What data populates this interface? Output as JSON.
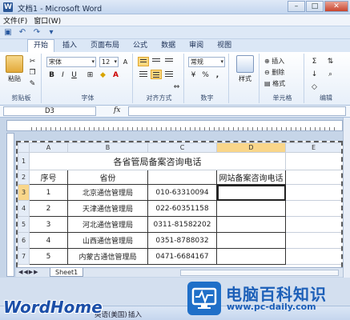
{
  "window": {
    "title": "文档1 - Microsoft Word",
    "app_icon": "W",
    "btn_min": "–",
    "btn_max": "□",
    "btn_close": "✕"
  },
  "menubar": {
    "items": [
      "文件(F)",
      "窗口(W)"
    ]
  },
  "ribbon_tabs": {
    "file": "文件",
    "items": [
      "开始",
      "插入",
      "页面布局",
      "公式",
      "数据",
      "审阅",
      "视图"
    ],
    "active_index": 0
  },
  "ribbon": {
    "clipboard_label": "剪贴板",
    "paste_label": "粘贴",
    "font_label": "字体",
    "font_name": "宋体",
    "font_size": "12",
    "align_label": "对齐方式",
    "number_label": "数字",
    "number_format": "常规",
    "style_label": "样式",
    "cells_label": "单元格",
    "insert_label": "插入",
    "delete_label": "删除",
    "format_label": "格式",
    "editing_label": "编辑",
    "bold": "B",
    "italic": "I",
    "underline": "U",
    "percent": "%",
    "thousands": ","
  },
  "formula_bar": {
    "name_box": "D3",
    "fx": "fx",
    "content": ""
  },
  "sheet": {
    "columns": [
      "A",
      "B",
      "C",
      "D",
      "E"
    ],
    "title": "各省管局备案咨询电话",
    "headers": [
      "序号",
      "省份",
      "",
      "网站备案咨询电话"
    ],
    "rows": [
      {
        "row": "3",
        "no": "1",
        "province": "北京通信管理局",
        "phone": "010-63310094"
      },
      {
        "row": "4",
        "no": "2",
        "province": "天津通信管理局",
        "phone": "022-60351158"
      },
      {
        "row": "5",
        "no": "3",
        "province": "河北通信管理局",
        "phone": "0311-81582202"
      },
      {
        "row": "6",
        "no": "4",
        "province": "山西通信管理局",
        "phone": "0351-8788032"
      },
      {
        "row": "7",
        "no": "5",
        "province": "内蒙古通信管理局",
        "phone": "0471-6684167"
      }
    ],
    "row_labels": [
      "1",
      "2"
    ],
    "selected_cell": "D3",
    "sheet_tab": "Sheet1"
  },
  "statusbar": {
    "lang": "英语(美国)",
    "mode": "插入"
  },
  "watermark": {
    "left_brand": "WordHome",
    "right_brand": "电脑百科知识",
    "url": "www.pc-daily.com"
  },
  "colors": {
    "accent": "#2b5797",
    "selection_header": "#f9d68a"
  }
}
